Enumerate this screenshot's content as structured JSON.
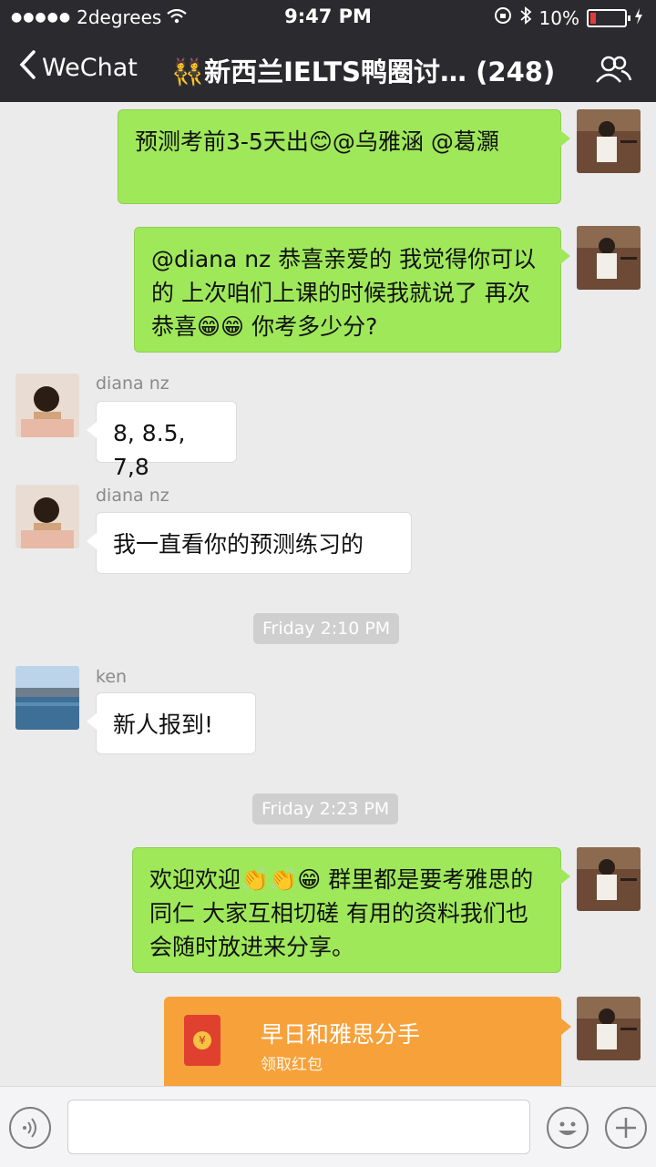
{
  "status_bar": {
    "carrier": "2degrees",
    "time": "9:47 PM",
    "battery": "10%"
  },
  "nav": {
    "back_label": "WeChat",
    "title": "👯新西兰IELTS鸭圈讨… (248)"
  },
  "messages": [
    {
      "text": "预测考前3-5天出😊@乌雅涵 @葛灝"
    },
    {
      "text": "@diana nz 恭喜亲爱的 我觉得你可以的 上次咱们上课的时候我就说了 再次恭喜😁😁 你考多少分?"
    },
    {
      "sender": "diana nz",
      "text": "8, 8.5, 7,8"
    },
    {
      "sender": "diana nz",
      "text": "我一直看你的预测练习的"
    },
    {
      "timestamp": "Friday 2:10 PM"
    },
    {
      "sender": "ken",
      "text": "新人报到!"
    },
    {
      "timestamp": "Friday 2:23 PM"
    },
    {
      "text": "欢迎欢迎👏👏😁 群里都是要考雅思的同仁 大家互相切磋 有用的资料我们也会随时放进来分享。"
    },
    {
      "red_packet_title": "早日和雅思分手",
      "red_packet_sub": "领取红包"
    }
  ],
  "colors": {
    "mine_bubble": "#9fe85a",
    "red_packet": "#f7a13b",
    "header": "#2b2b2f"
  }
}
